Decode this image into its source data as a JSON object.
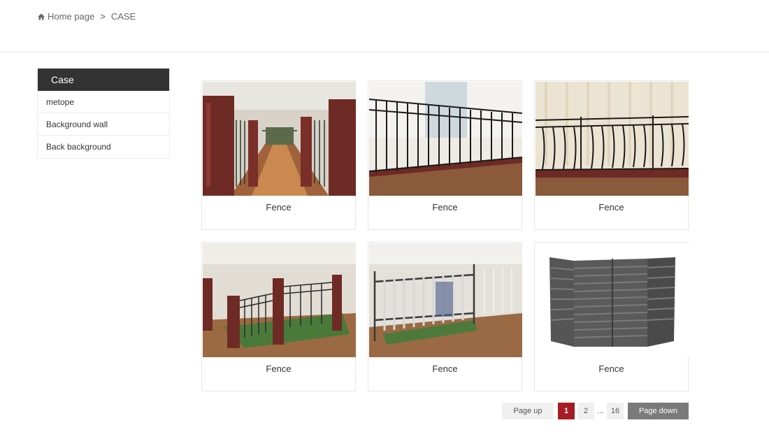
{
  "breadcrumb": {
    "home_label": "Home page",
    "separator": ">",
    "current": "CASE"
  },
  "sidebar": {
    "title": "Case",
    "items": [
      {
        "label": "metope"
      },
      {
        "label": "Background wall"
      },
      {
        "label": "Back background"
      }
    ]
  },
  "products": [
    {
      "caption": "Fence",
      "image": "marble-pillar-fence-corridor"
    },
    {
      "caption": "Fence",
      "image": "black-iron-railing-window"
    },
    {
      "caption": "Fence",
      "image": "wavy-iron-railing-curtain"
    },
    {
      "caption": "Fence",
      "image": "marble-pillar-fence-enclosure"
    },
    {
      "caption": "Fence",
      "image": "gray-spear-fence-showroom"
    },
    {
      "caption": "Fence",
      "image": "gray-louver-ac-cover"
    }
  ],
  "pagination": {
    "prev_label": "Page up",
    "pages": [
      "1",
      "2",
      "16"
    ],
    "current": "1",
    "ellipsis": "...",
    "next_label": "Page down"
  },
  "colors": {
    "sidebar_head": "#333333",
    "active_page": "#a51c24",
    "next_button": "#7a7a7a"
  }
}
